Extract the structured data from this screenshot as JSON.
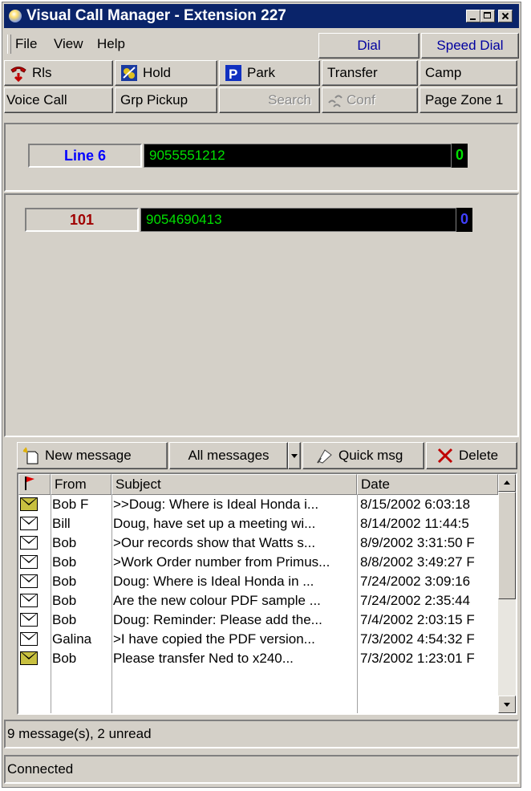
{
  "window": {
    "title": "Visual Call Manager - Extension 227",
    "controls": [
      "minimize-icon",
      "maximize-icon",
      "close-icon"
    ]
  },
  "menu": {
    "items": [
      {
        "label": "File"
      },
      {
        "label": "View"
      },
      {
        "label": "Help"
      }
    ],
    "dial_label": "Dial",
    "speed_dial_label": "Speed Dial"
  },
  "toolbar": {
    "row1": [
      {
        "label": "Rls",
        "icon": "phone-release-icon"
      },
      {
        "label": "Hold",
        "icon": "hold-icon"
      },
      {
        "label": "Park",
        "icon": "park-icon"
      },
      {
        "label": "Transfer"
      },
      {
        "label": "Camp"
      }
    ],
    "row2": [
      {
        "label": "Voice Call"
      },
      {
        "label": "Grp Pickup"
      },
      {
        "label": "Search",
        "disabled": true
      },
      {
        "label": "Conf",
        "icon": "conference-icon",
        "disabled": true
      },
      {
        "label": "Page Zone 1"
      }
    ]
  },
  "line": {
    "label": "Line 6",
    "label_color": "#0000ff",
    "number": "9055551212",
    "count": "0",
    "count_color": "#00e000"
  },
  "extension": {
    "label": "101",
    "label_color": "#a00000",
    "number": "9054690413",
    "count": "0",
    "count_color": "#4040ff"
  },
  "messages_toolbar": {
    "new_message": "New message",
    "filter": "All messages",
    "quick_msg": "Quick msg",
    "delete": "Delete"
  },
  "messages": {
    "columns": {
      "flag": "flag-icon",
      "from": "From",
      "subject": "Subject",
      "date": "Date"
    },
    "rows": [
      {
        "from": "Bob F",
        "subject": ">>Doug: Where is Ideal Honda i...",
        "date": "8/15/2002 6:03:18",
        "unread": true
      },
      {
        "from": "Bill",
        "subject": "Doug, have set up a meeting wi...",
        "date": "8/14/2002 11:44:5",
        "unread": false
      },
      {
        "from": "Bob",
        "subject": ">Our records show that Watts s...",
        "date": "8/9/2002 3:31:50 F",
        "unread": false
      },
      {
        "from": "Bob",
        "subject": ">Work Order number from Primus...",
        "date": "8/8/2002 3:49:27 F",
        "unread": false
      },
      {
        "from": "Bob",
        "subject": "Doug: Where is Ideal Honda in ...",
        "date": "7/24/2002 3:09:16",
        "unread": false
      },
      {
        "from": "Bob",
        "subject": "Are the new colour PDF sample ...",
        "date": "7/24/2002 2:35:44",
        "unread": false
      },
      {
        "from": "Bob",
        "subject": "Doug: Reminder: Please add the...",
        "date": "7/4/2002 2:03:15 F",
        "unread": false
      },
      {
        "from": "Galina",
        "subject": ">I have copied the PDF version...",
        "date": "7/3/2002 4:54:32 F",
        "unread": false
      },
      {
        "from": "Bob",
        "subject": "Please transfer Ned to x240...",
        "date": "7/3/2002 1:23:01 F",
        "unread": true
      }
    ]
  },
  "status": {
    "summary": "9 message(s), 2 unread",
    "connection": "Connected"
  }
}
